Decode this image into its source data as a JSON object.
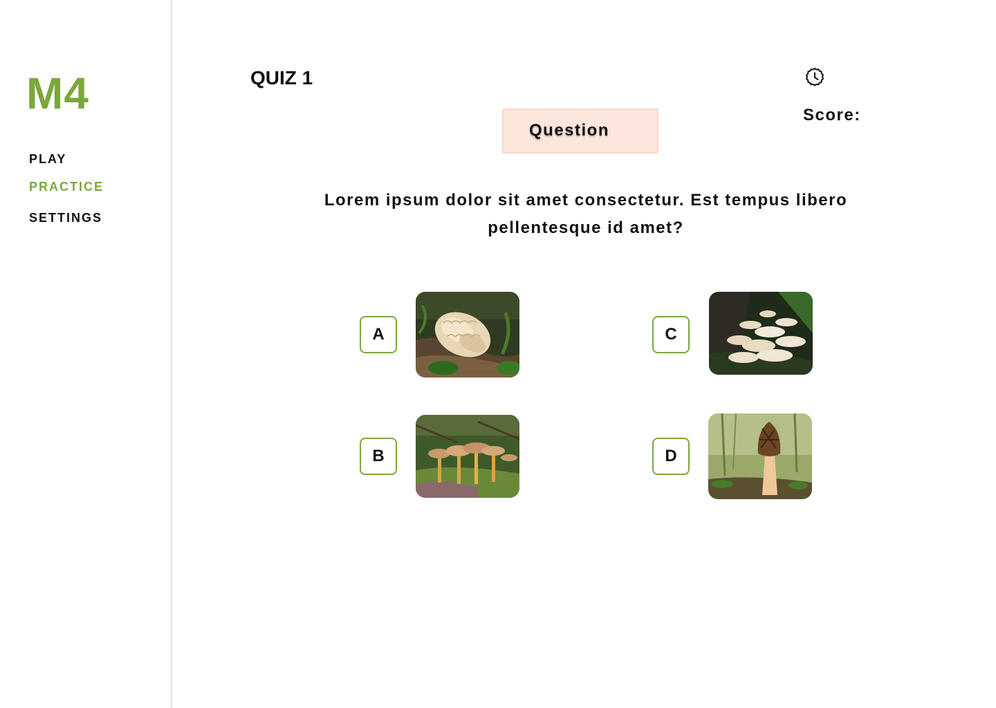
{
  "app": {
    "logo": "M4"
  },
  "sidebar": {
    "items": [
      {
        "label": "PLAY",
        "active": false
      },
      {
        "label": "PRACTICE",
        "active": true
      },
      {
        "label": "SETTINGS",
        "active": false
      }
    ]
  },
  "header": {
    "title": "QUIZ 1",
    "timer_icon": "clock-icon",
    "score_label": "Score:"
  },
  "question": {
    "badge_label": "Question",
    "text": "Lorem ipsum dolor sit amet consectetur. Est tempus libero pellentesque id amet?"
  },
  "options": [
    {
      "letter": "A",
      "image": "cauliflower-mushroom-photo"
    },
    {
      "letter": "B",
      "image": "chanterelle-cluster-photo"
    },
    {
      "letter": "C",
      "image": "oyster-mushroom-photo"
    },
    {
      "letter": "D",
      "image": "morel-mushroom-photo"
    }
  ],
  "colors": {
    "accent": "#7aa83c",
    "badge_bg": "#fde6dc",
    "badge_border": "#f8d6c6",
    "divider": "#cfcfcf",
    "text": "#111111"
  }
}
